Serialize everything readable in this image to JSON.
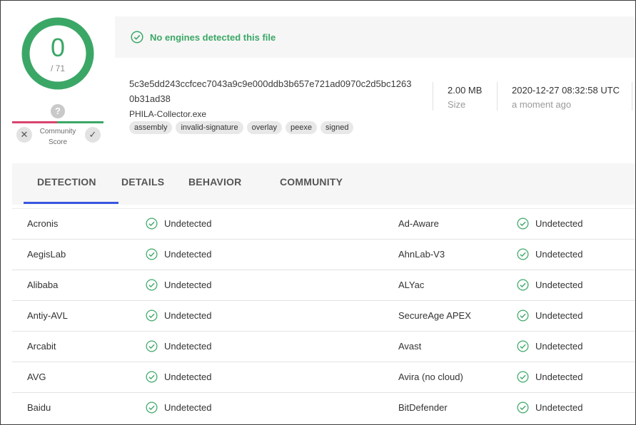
{
  "score": {
    "detections": "0",
    "total": "/ 71",
    "help_glyph": "?",
    "community_label": "Community Score"
  },
  "status": {
    "message": "No engines detected this file",
    "color": "#3ba766"
  },
  "file": {
    "hash_line1": "5c3e5dd243ccfcec7043a9c9e000ddb3b657e721ad0970c2d5bc1263",
    "hash_line2": "0b31ad38",
    "name": "PHILA-Collector.exe",
    "tags": [
      "assembly",
      "invalid-signature",
      "overlay",
      "peexe",
      "signed"
    ],
    "size": "2.00 MB",
    "size_label": "Size",
    "date": "2020-12-27 08:32:58 UTC",
    "date_label": "a moment ago"
  },
  "tabs": [
    "DETECTION",
    "DETAILS",
    "BEHAVIOR",
    "COMMUNITY"
  ],
  "results": [
    {
      "left_engine": "Acronis",
      "left_result": "Undetected",
      "right_engine": "Ad-Aware",
      "right_result": "Undetected"
    },
    {
      "left_engine": "AegisLab",
      "left_result": "Undetected",
      "right_engine": "AhnLab-V3",
      "right_result": "Undetected"
    },
    {
      "left_engine": "Alibaba",
      "left_result": "Undetected",
      "right_engine": "ALYac",
      "right_result": "Undetected"
    },
    {
      "left_engine": "Antiy-AVL",
      "left_result": "Undetected",
      "right_engine": "SecureAge APEX",
      "right_result": "Undetected"
    },
    {
      "left_engine": "Arcabit",
      "left_result": "Undetected",
      "right_engine": "Avast",
      "right_result": "Undetected"
    },
    {
      "left_engine": "AVG",
      "left_result": "Undetected",
      "right_engine": "Avira (no cloud)",
      "right_result": "Undetected"
    },
    {
      "left_engine": "Baidu",
      "left_result": "Undetected",
      "right_engine": "BitDefender",
      "right_result": "Undetected"
    }
  ],
  "colors": {
    "accent_green": "#3ba766",
    "malicious_red": "#d9436f",
    "tab_indicator": "#3a57e0"
  }
}
